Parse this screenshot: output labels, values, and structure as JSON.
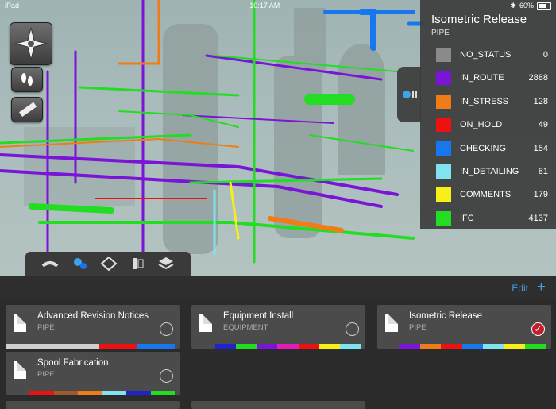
{
  "statusbar": {
    "carrier": "iPad",
    "time": "10:17 AM",
    "battery": "60%"
  },
  "status_panel": {
    "title": "Isometric Release",
    "subtitle": "PIPE",
    "rows": [
      {
        "name": "NO_STATUS",
        "count": "0",
        "color": "#8a8a8a"
      },
      {
        "name": "IN_ROUTE",
        "count": "2888",
        "color": "#7a14d6"
      },
      {
        "name": "IN_STRESS",
        "count": "128",
        "color": "#f07b17"
      },
      {
        "name": "ON_HOLD",
        "count": "49",
        "color": "#ee1111"
      },
      {
        "name": "CHECKING",
        "count": "154",
        "color": "#1777ee"
      },
      {
        "name": "IN_DETAILING",
        "count": "81",
        "color": "#7fe4f0"
      },
      {
        "name": "COMMENTS",
        "count": "179",
        "color": "#f7ef18"
      },
      {
        "name": "IFC",
        "count": "4137",
        "color": "#22dd22"
      }
    ]
  },
  "editbar": {
    "edit_label": "Edit",
    "add_label": "+"
  },
  "cards": [
    {
      "title": "Advanced Revision Notices",
      "subtitle": "PIPE",
      "selected": false,
      "strip": [
        "#cfcfcf",
        "#cfcfcf",
        "#cfcfcf",
        "#cfcfcf",
        "#cfcfcf",
        "#ee1111",
        "#ee1111",
        "#1777ee",
        "#1777ee"
      ]
    },
    {
      "title": "Equipment Install",
      "subtitle": "EQUIPMENT",
      "selected": false,
      "strip": [
        "#2222cc",
        "#22dd22",
        "#7a14d6",
        "#e21cb6",
        "#ee1111",
        "#f7ef18",
        "#7fe4f0"
      ]
    },
    {
      "title": "Isometric Release",
      "subtitle": "PIPE",
      "selected": true,
      "strip": [
        "#7a14d6",
        "#f07b17",
        "#ee1111",
        "#1777ee",
        "#7fe4f0",
        "#f7ef18",
        "#22dd22"
      ]
    },
    {
      "title": "Spool Fabrication",
      "subtitle": "PIPE",
      "selected": false,
      "strip": [
        "#ee1111",
        "#a05a2c",
        "#f07b17",
        "#7fe4f0",
        "#2222cc",
        "#22dd22"
      ]
    }
  ]
}
